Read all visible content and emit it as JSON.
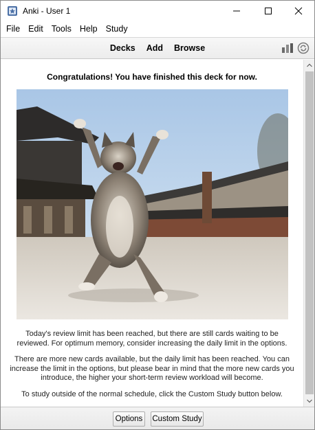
{
  "window": {
    "title": "Anki - User 1",
    "minimize_icon": "minimize-icon",
    "maximize_icon": "maximize-icon",
    "close_icon": "close-icon"
  },
  "menu": {
    "items": [
      "File",
      "Edit",
      "Tools",
      "Help",
      "Study"
    ]
  },
  "toolbar": {
    "links": [
      "Decks",
      "Add",
      "Browse"
    ],
    "stats_icon": "stats-bar-chart-icon",
    "sync_icon": "sync-icon"
  },
  "content": {
    "congrats": "Congratulations! You have finished this deck for now.",
    "image_description": "cat-photo",
    "message_review": "Today's review limit has been reached, but there are still cards waiting to be reviewed. For optimum memory, consider increasing the daily limit in the options.",
    "message_new": "There are more new cards available, but the daily limit has been reached. You can increase the limit in the options, but please bear in mind that the more new cards you introduce, the higher your short-term review workload will become.",
    "message_custom": "To study outside of the normal schedule, click the Custom Study button below."
  },
  "bottom": {
    "options_label": "Options",
    "custom_study_label": "Custom Study"
  },
  "colors": {
    "toolbar_bg": "#efefef",
    "scroll_thumb": "#c2c2c2"
  }
}
